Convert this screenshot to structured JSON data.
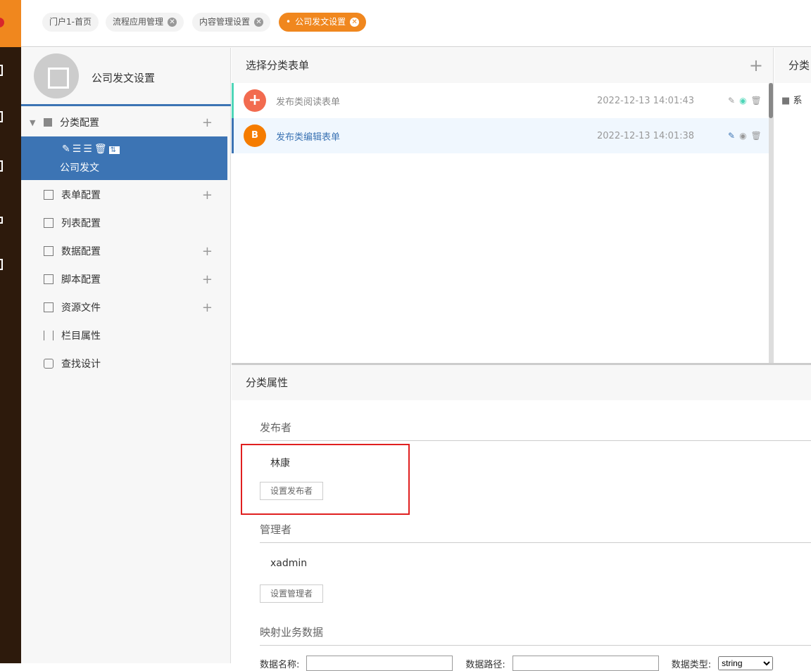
{
  "tabs": [
    {
      "label": "门户1-首页",
      "closable": false
    },
    {
      "label": "流程应用管理",
      "closable": true
    },
    {
      "label": "内容管理设置",
      "closable": true
    },
    {
      "label": "公司发文设置",
      "closable": true,
      "active": true
    }
  ],
  "left": {
    "title": "公司发文设置",
    "menu": [
      {
        "label": "分类配置",
        "icon": "category-icon",
        "add": true
      },
      {
        "label": "表单配置",
        "icon": "form-icon",
        "add": true
      },
      {
        "label": "列表配置",
        "icon": "list-icon",
        "add": false
      },
      {
        "label": "数据配置",
        "icon": "chart-icon",
        "add": true
      },
      {
        "label": "脚本配置",
        "icon": "script-icon",
        "add": true
      },
      {
        "label": "资源文件",
        "icon": "resource-icon",
        "add": true
      },
      {
        "label": "栏目属性",
        "icon": "sliders-icon",
        "add": false
      },
      {
        "label": "查找设计",
        "icon": "binoculars-icon",
        "add": false
      }
    ],
    "selected_category": "公司发文"
  },
  "forms": {
    "title": "选择分类表单",
    "items": [
      {
        "name": "发布类阅读表单",
        "date": "2022-12-13 14:01:43",
        "color": "#f26b4f"
      },
      {
        "name": "发布类编辑表单",
        "date": "2022-12-13 14:01:38",
        "color": "#f57c00",
        "selected": true
      }
    ]
  },
  "right": {
    "title": "分类",
    "item": "系"
  },
  "props": {
    "title": "分类属性",
    "publisher": {
      "label": "发布者",
      "value": "林康",
      "button": "设置发布者"
    },
    "manager": {
      "label": "管理者",
      "value": "xadmin",
      "button": "设置管理者"
    },
    "mapping": {
      "label": "映射业务数据",
      "name_label": "数据名称:",
      "path_label": "数据路径:",
      "type_label": "数据类型:",
      "type_value": "string"
    }
  },
  "colors": {
    "accent": "#f0871e",
    "primary": "#3c74b4",
    "highlight": "#e02020"
  }
}
